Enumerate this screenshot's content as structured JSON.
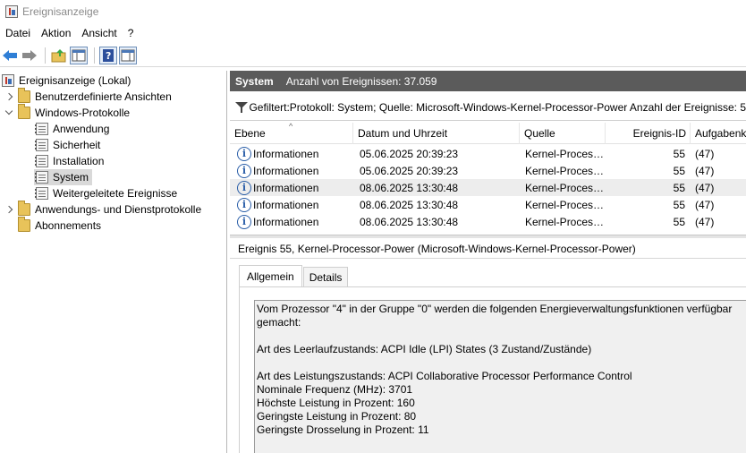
{
  "window": {
    "title": "Ereignisanzeige"
  },
  "menu": [
    "Datei",
    "Aktion",
    "Ansicht",
    "?"
  ],
  "tree": [
    {
      "label": "Ereignisanzeige (Lokal)",
      "level": 0,
      "expander": "none",
      "icon": "event-viewer-icon"
    },
    {
      "label": "Benutzerdefinierte Ansichten",
      "level": 1,
      "expander": "collapsed",
      "icon": "folder-icon"
    },
    {
      "label": "Windows-Protokolle",
      "level": 1,
      "expander": "expanded",
      "icon": "folder-icon"
    },
    {
      "label": "Anwendung",
      "level": 2,
      "expander": "none",
      "icon": "log-icon"
    },
    {
      "label": "Sicherheit",
      "level": 2,
      "expander": "none",
      "icon": "log-icon"
    },
    {
      "label": "Installation",
      "level": 2,
      "expander": "none",
      "icon": "log-icon"
    },
    {
      "label": "System",
      "level": 2,
      "expander": "none",
      "icon": "log-icon",
      "selected": true
    },
    {
      "label": "Weitergeleitete Ereignisse",
      "level": 2,
      "expander": "none",
      "icon": "log-icon"
    },
    {
      "label": "Anwendungs- und Dienstprotokolle",
      "level": 1,
      "expander": "collapsed",
      "icon": "folder-icon"
    },
    {
      "label": "Abonnements",
      "level": 1,
      "expander": "none",
      "icon": "subscription-icon"
    }
  ],
  "header": {
    "title": "System",
    "count_text": "Anzahl von Ereignissen: 37.059"
  },
  "filter": {
    "text": "Gefiltert:Protokoll: System; Quelle: Microsoft-Windows-Kernel-Processor-Power Anzahl der Ereignisse: 5"
  },
  "table": {
    "columns": [
      "Ebene",
      "Datum und Uhrzeit",
      "Quelle",
      "Ereignis-ID",
      "Aufgabenkategorie"
    ],
    "rows": [
      {
        "level": "Informationen",
        "datetime": "05.06.2025 20:39:23",
        "source": "Kernel-Proces…",
        "id": "55",
        "task": "(47)"
      },
      {
        "level": "Informationen",
        "datetime": "05.06.2025 20:39:23",
        "source": "Kernel-Proces…",
        "id": "55",
        "task": "(47)"
      },
      {
        "level": "Informationen",
        "datetime": "08.06.2025 13:30:48",
        "source": "Kernel-Proces…",
        "id": "55",
        "task": "(47)",
        "highlight": true
      },
      {
        "level": "Informationen",
        "datetime": "08.06.2025 13:30:48",
        "source": "Kernel-Proces…",
        "id": "55",
        "task": "(47)"
      },
      {
        "level": "Informationen",
        "datetime": "08.06.2025 13:30:48",
        "source": "Kernel-Proces…",
        "id": "55",
        "task": "(47)"
      }
    ]
  },
  "detail": {
    "title": "Ereignis 55, Kernel-Processor-Power (Microsoft-Windows-Kernel-Processor-Power)",
    "tabs": [
      "Allgemein",
      "Details"
    ],
    "description_lines": [
      "Vom Prozessor \"4\" in der Gruppe \"0\" werden die folgenden Energieverwaltungsfunktionen verfügbar",
      "gemacht:",
      "",
      "Art des Leerlaufzustands: ACPI Idle (LPI) States (3 Zustand/Zustände)",
      "",
      "Art des Leistungszustands: ACPI Collaborative Processor Performance Control",
      "Nominale Frequenz (MHz): 3701",
      "Höchste Leistung in Prozent: 160",
      "Geringste Leistung in Prozent: 80",
      "Geringste Drosselung in Prozent: 11"
    ]
  }
}
